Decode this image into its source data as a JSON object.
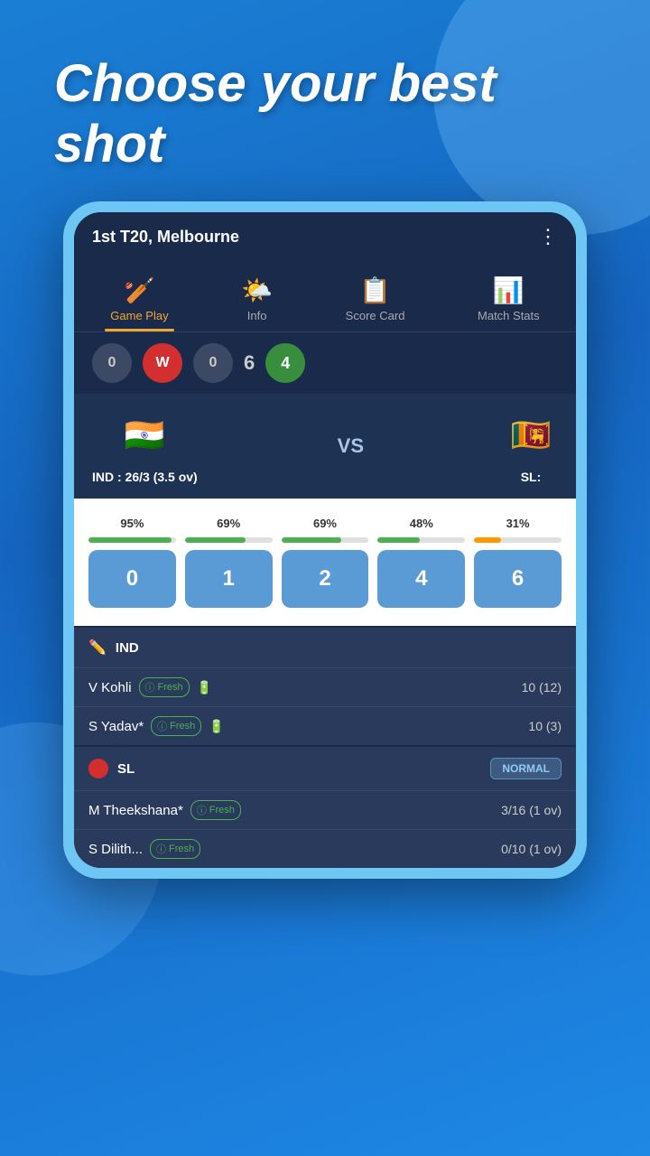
{
  "hero": {
    "title": "Choose your best shot"
  },
  "match": {
    "title": "1st T20, Melbourne",
    "more_icon": "⋮"
  },
  "tabs": [
    {
      "id": "gameplay",
      "label": "Game Play",
      "icon": "🏏",
      "active": true
    },
    {
      "id": "info",
      "label": "Info",
      "icon": "🌤️",
      "active": false
    },
    {
      "id": "scorecard",
      "label": "Score Card",
      "icon": "📋",
      "active": false
    },
    {
      "id": "matchstats",
      "label": "Match Stats",
      "icon": "📊",
      "active": false
    }
  ],
  "balls": [
    {
      "type": "dot",
      "value": "0"
    },
    {
      "type": "wicket",
      "value": "W"
    },
    {
      "type": "dot",
      "value": "0"
    },
    {
      "type": "number",
      "value": "6"
    },
    {
      "type": "special",
      "value": "4"
    }
  ],
  "teams": {
    "home": {
      "flag": "🇮🇳",
      "name": "IND",
      "score": "IND : 26/3 (3.5 ov)"
    },
    "away": {
      "flag": "🇱🇰",
      "name": "SL",
      "score": "SL:"
    },
    "vs": "VS"
  },
  "shots": [
    {
      "label": "0",
      "pct": 95,
      "bar_color": "green"
    },
    {
      "label": "1",
      "pct": 69,
      "bar_color": "green"
    },
    {
      "label": "2",
      "pct": 69,
      "bar_color": "green"
    },
    {
      "label": "4",
      "pct": 48,
      "bar_color": "green"
    },
    {
      "label": "6",
      "pct": 31,
      "bar_color": "orange"
    }
  ],
  "ind_team": {
    "label": "IND",
    "icon": "✏️",
    "players": [
      {
        "name": "V Kohli",
        "fresh": "Fresh",
        "score": "10 (12)"
      },
      {
        "name": "S Yadav*",
        "fresh": "Fresh",
        "score": "10 (3)"
      }
    ]
  },
  "sl_team": {
    "label": "SL",
    "mode": "NORMAL",
    "players": [
      {
        "name": "M Theekshana*",
        "fresh": "Fresh",
        "score": "3/16 (1 ov)"
      },
      {
        "name": "S Dilith...",
        "fresh": "Fresh",
        "score": "0/10 (1 ov)"
      }
    ]
  }
}
